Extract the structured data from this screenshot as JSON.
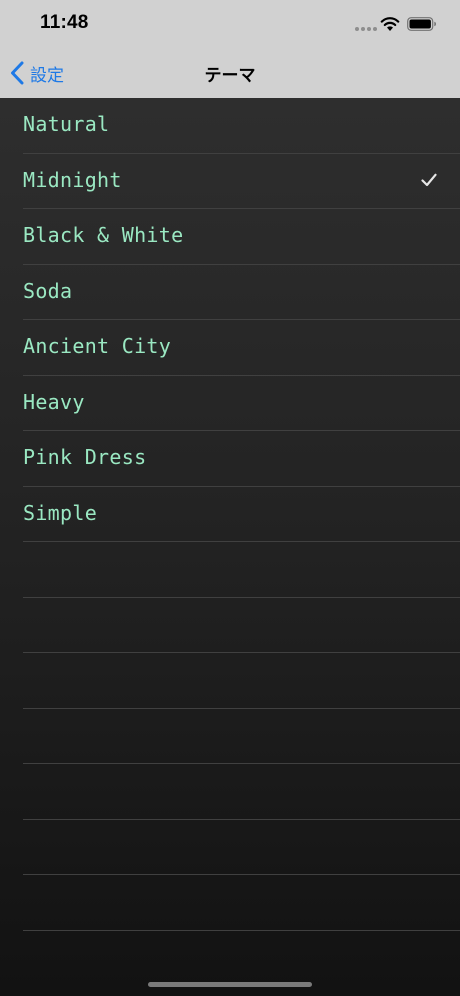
{
  "status_bar": {
    "time": "11:48"
  },
  "nav": {
    "back_label": "設定",
    "title": "テーマ"
  },
  "themes": [
    {
      "label": "Natural",
      "selected": false
    },
    {
      "label": "Midnight",
      "selected": true
    },
    {
      "label": "Black & White",
      "selected": false
    },
    {
      "label": "Soda",
      "selected": false
    },
    {
      "label": "Ancient City",
      "selected": false
    },
    {
      "label": "Heavy",
      "selected": false
    },
    {
      "label": "Pink Dress",
      "selected": false
    },
    {
      "label": "Simple",
      "selected": false
    }
  ],
  "colors": {
    "accent": "#1e79e6",
    "row_text": "#9ae8c2",
    "bar_background": "#d1d1d1"
  },
  "icons": {
    "back": "chevron-left-icon",
    "selected": "checkmark-icon",
    "wifi": "wifi-icon",
    "battery": "battery-icon"
  }
}
